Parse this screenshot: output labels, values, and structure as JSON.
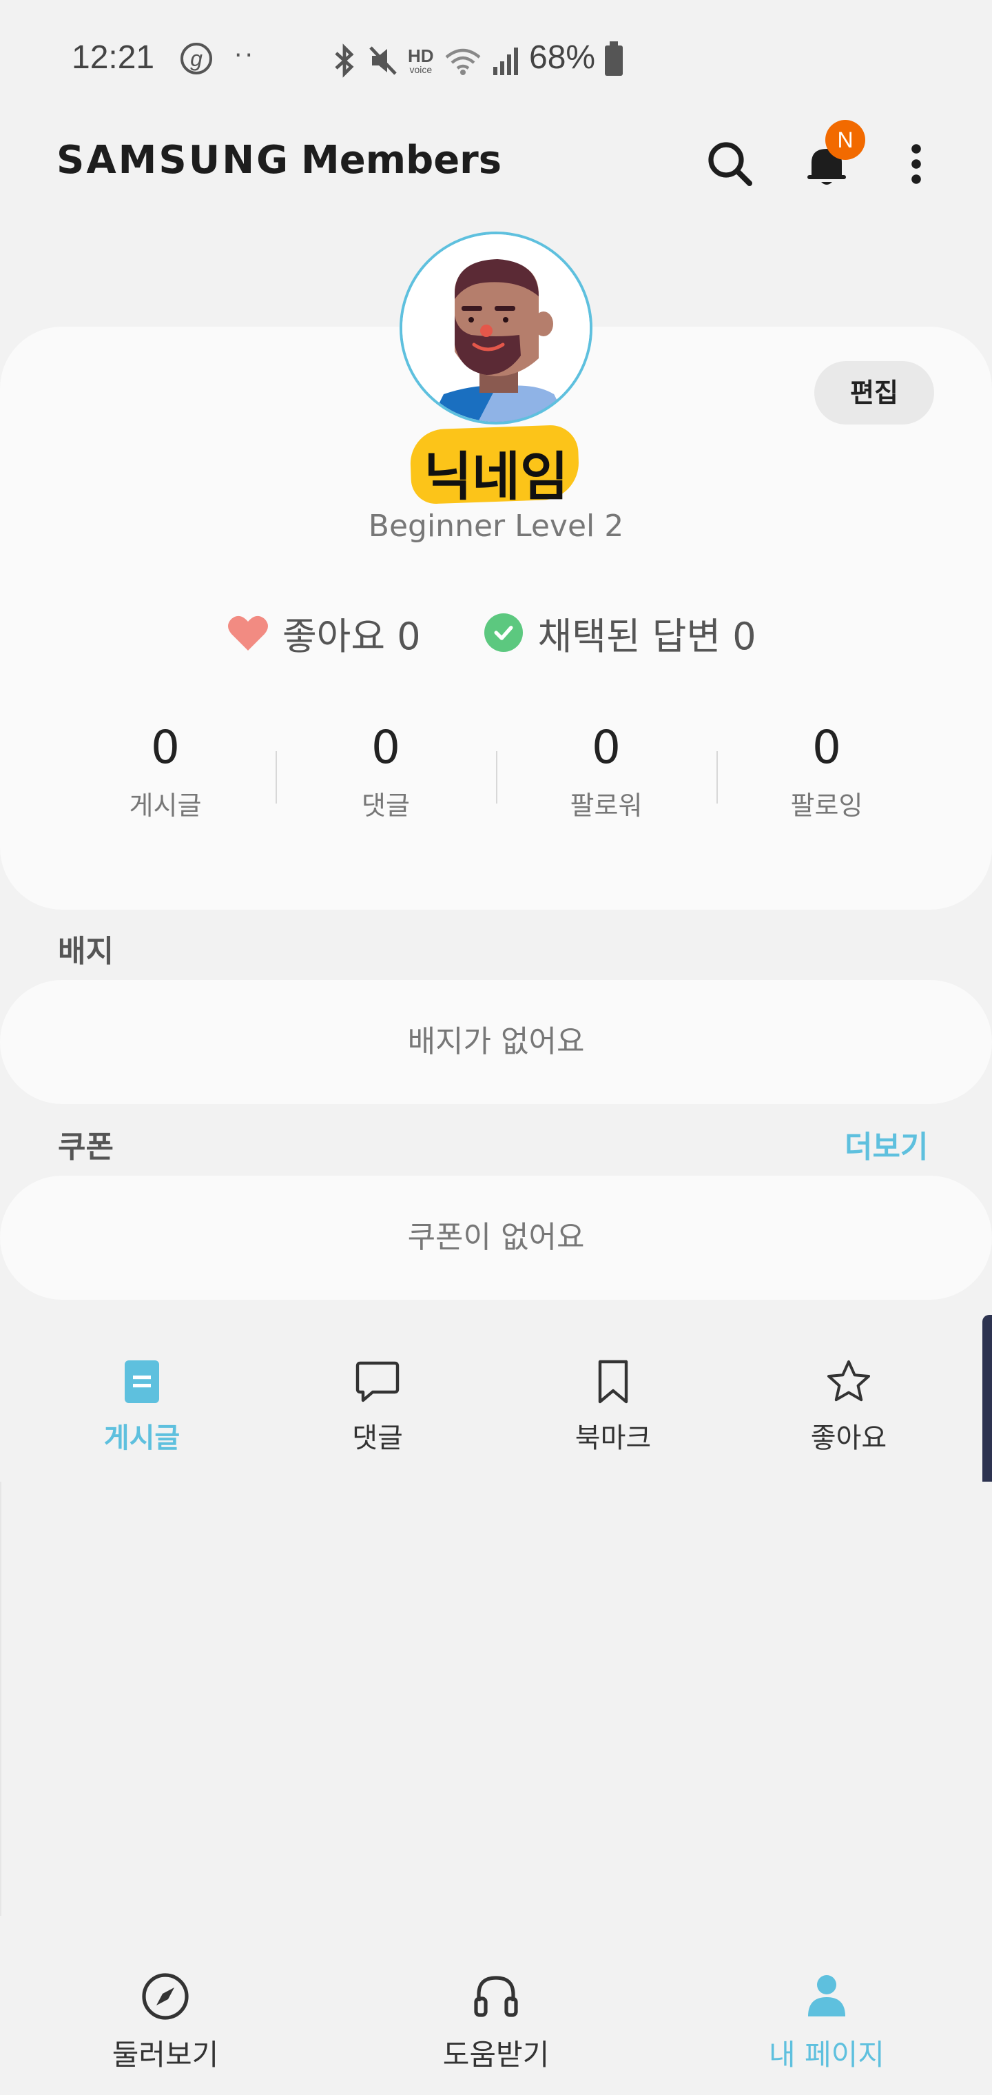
{
  "status_bar": {
    "time": "12:21",
    "g_icon_letter": "g",
    "dots": "··",
    "hd_label": "HD",
    "voice_label": "voice",
    "battery_text": "68%"
  },
  "app_bar": {
    "brand": "SAMSUNG",
    "product": "Members",
    "notification_badge": "N",
    "accent_color": "#5ec0de",
    "badge_color": "#f26a00"
  },
  "profile": {
    "edit_label": "편집",
    "nickname": "닉네임",
    "level": "Beginner Level 2",
    "likes": "좋아요 0",
    "accepted_answers": "채택된 답변 0",
    "counts": [
      {
        "value": "0",
        "label": "게시글"
      },
      {
        "value": "0",
        "label": "댓글"
      },
      {
        "value": "0",
        "label": "팔로워"
      },
      {
        "value": "0",
        "label": "팔로잉"
      }
    ]
  },
  "badges": {
    "title": "배지",
    "empty_text": "배지가 없어요"
  },
  "coupons": {
    "title": "쿠폰",
    "more_label": "더보기",
    "empty_text": "쿠폰이 없어요"
  },
  "tabs": [
    {
      "label": "게시글",
      "icon": "document-icon",
      "active": true
    },
    {
      "label": "댓글",
      "icon": "comment-icon",
      "active": false
    },
    {
      "label": "북마크",
      "icon": "bookmark-icon",
      "active": false
    },
    {
      "label": "좋아요",
      "icon": "star-icon",
      "active": false
    }
  ],
  "bottom_nav": [
    {
      "label": "둘러보기",
      "icon": "compass-icon",
      "active": false
    },
    {
      "label": "도움받기",
      "icon": "headset-icon",
      "active": false
    },
    {
      "label": "내 페이지",
      "icon": "person-icon",
      "active": true
    }
  ]
}
